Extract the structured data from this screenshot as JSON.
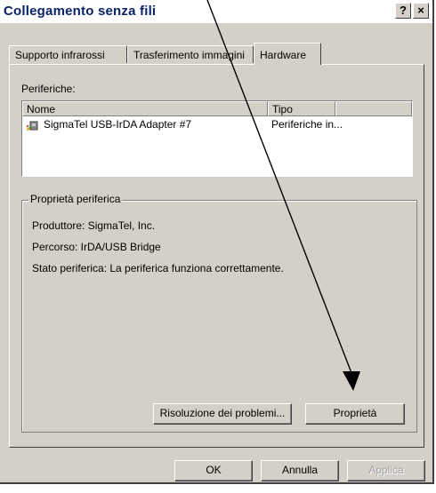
{
  "window": {
    "title": "Collegamento senza fili",
    "help_label": "?",
    "close_label": "×"
  },
  "tabs": [
    {
      "label": "Supporto infrarossi",
      "active": false
    },
    {
      "label": "Trasferimento immagini",
      "active": false
    },
    {
      "label": "Hardware",
      "active": true
    }
  ],
  "devices": {
    "label": "Periferiche:",
    "columns": [
      "Nome",
      "Tipo"
    ],
    "rows": [
      {
        "icon": "infrared-device-icon",
        "name": "SigmaTel USB-IrDA Adapter #7",
        "type": "Periferiche in..."
      }
    ]
  },
  "properties": {
    "group_title": "Proprietà periferica",
    "manufacturer": "Produttore: SigmaTel, Inc.",
    "path": "Percorso:  IrDA/USB Bridge",
    "status": "Stato periferica: La periferica funziona correttamente.",
    "troubleshoot_label": "Risoluzione dei problemi...",
    "properties_label": "Proprietà"
  },
  "footer": {
    "ok_label": "OK",
    "cancel_label": "Annulla",
    "apply_label": "Applica",
    "apply_enabled": false
  },
  "colors": {
    "title_text": "#0a246a",
    "dialog_face": "#d4d0c8",
    "annotation_arrow": "#000000"
  }
}
